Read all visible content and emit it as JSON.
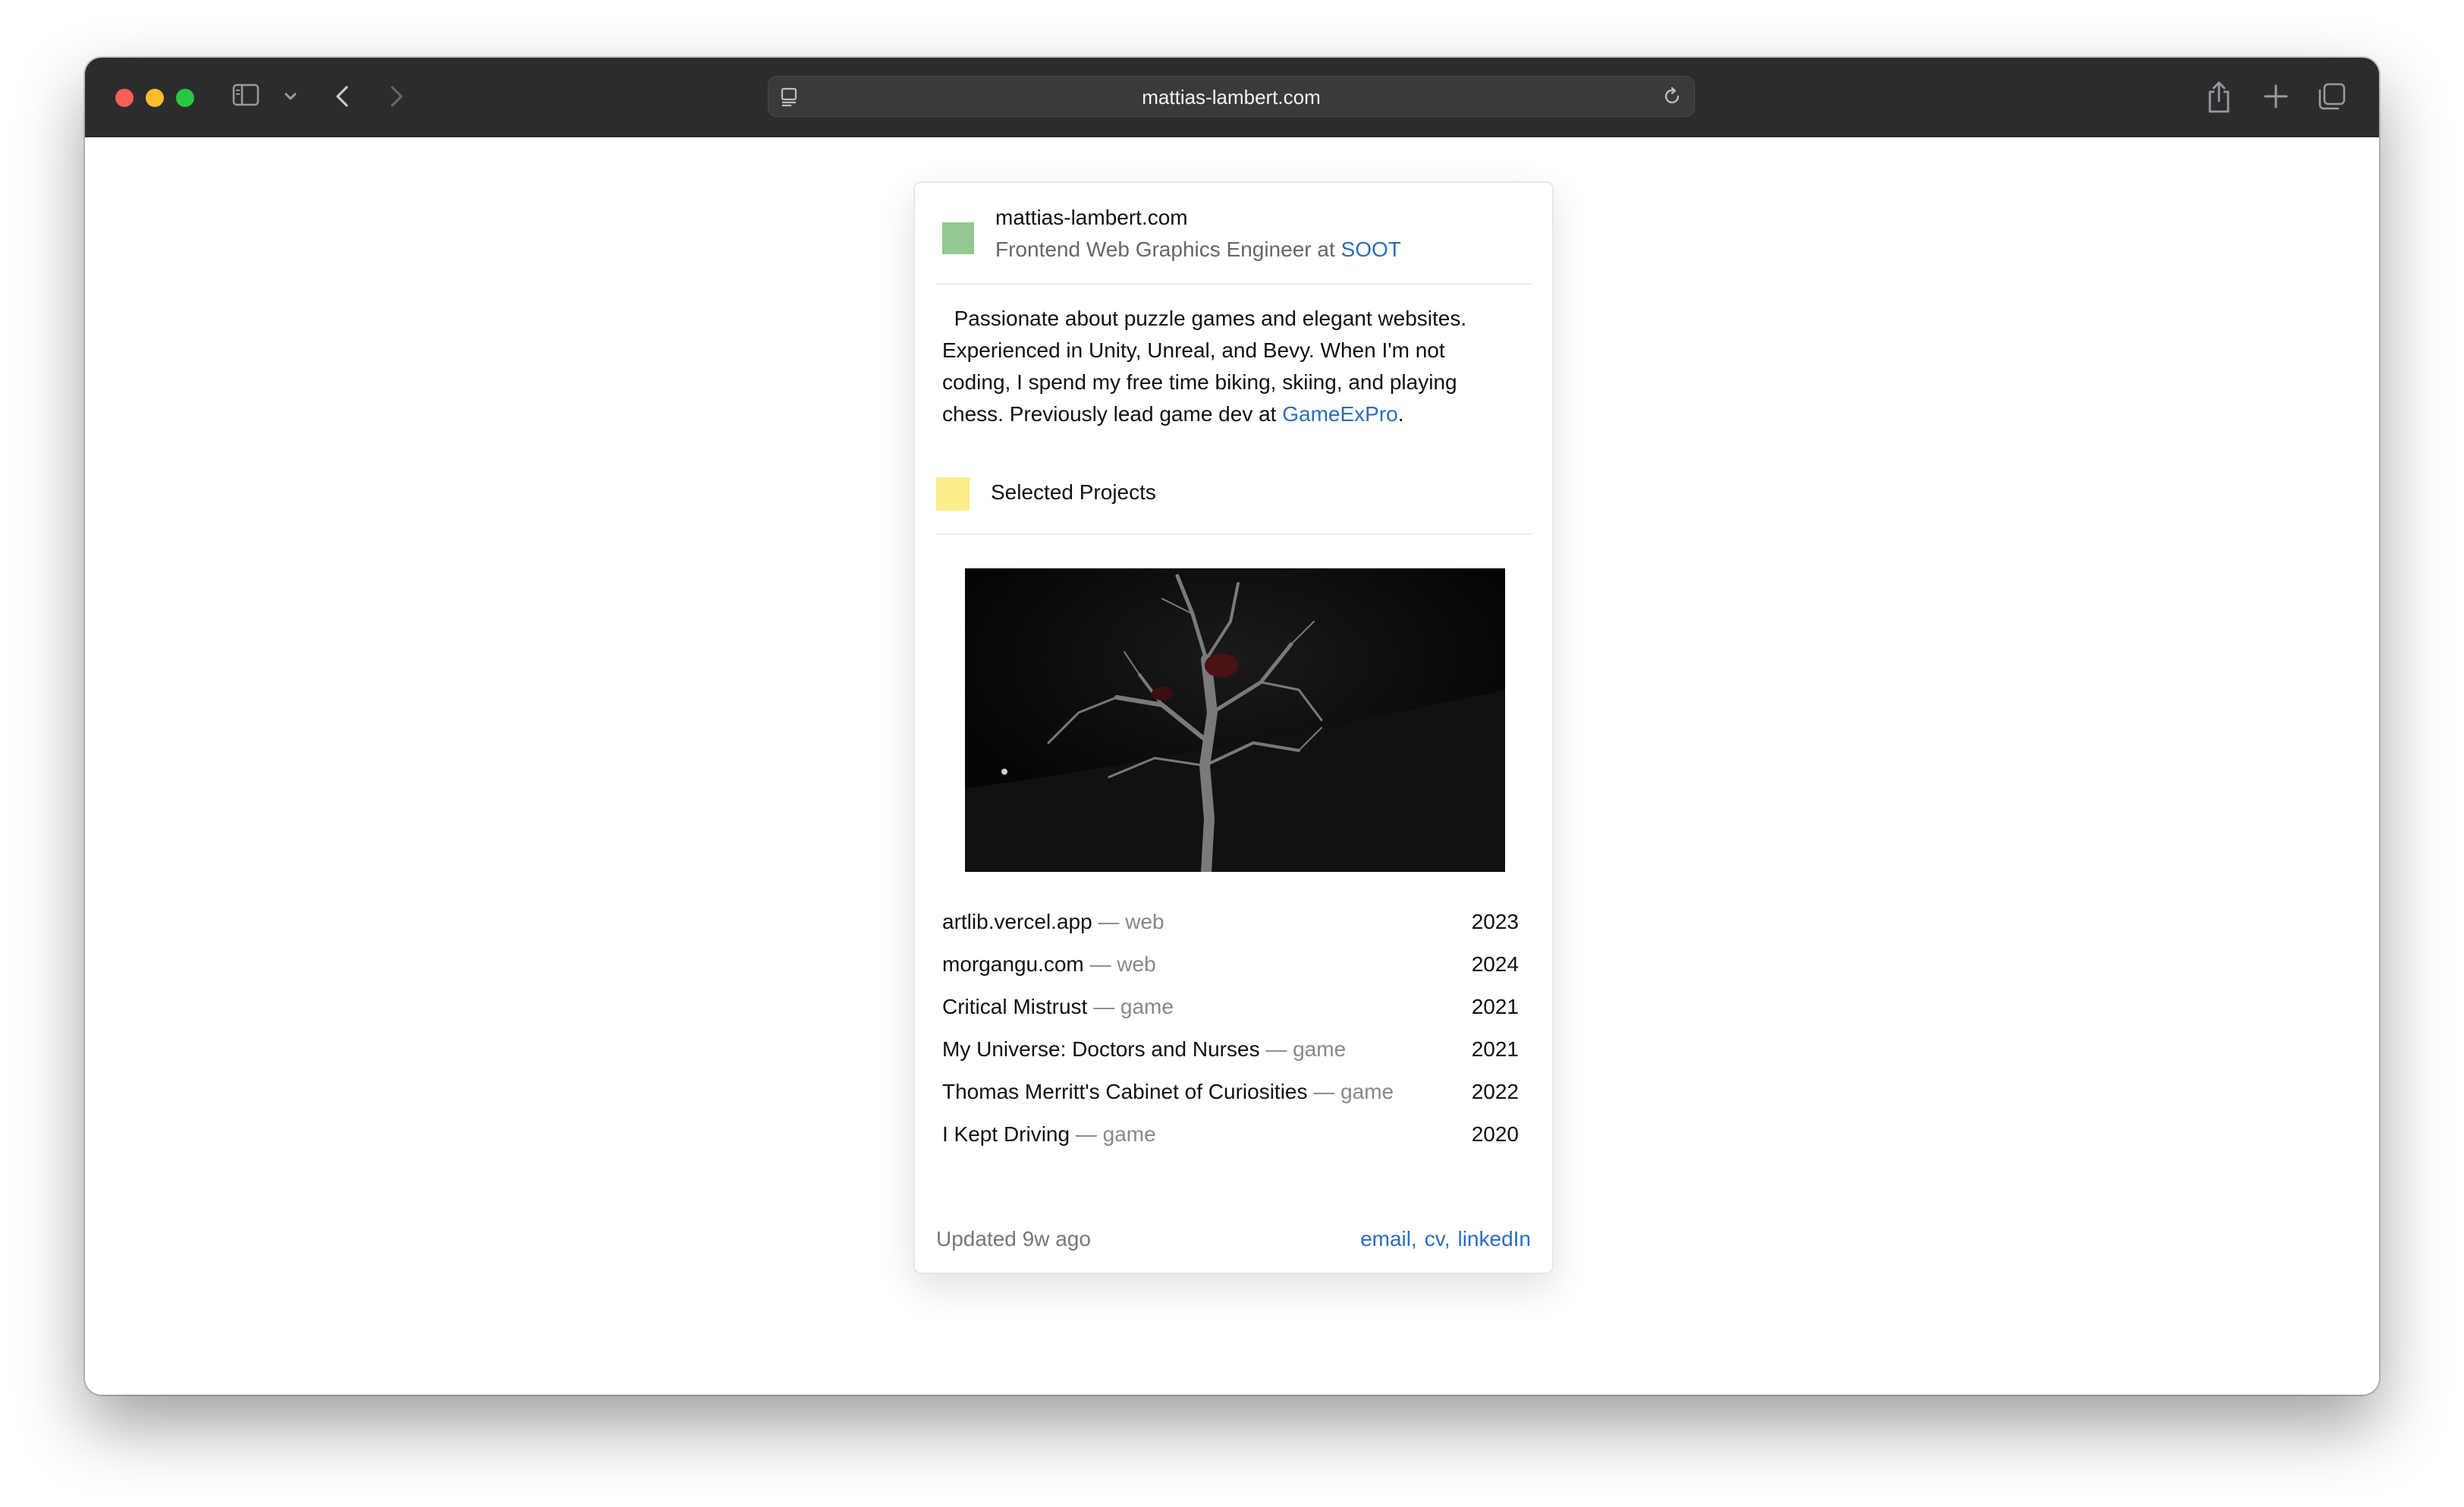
{
  "browser": {
    "url": "mattias-lambert.com"
  },
  "profile": {
    "site_name": "mattias-lambert.com",
    "role_prefix": "Frontend Web Graphics Engineer at",
    "company": "SOOT",
    "bio_text": "Passionate about puzzle games and elegant websites. Experienced in Unity, Unreal, and Bevy. When I'm not coding, I spend my free time biking, skiing, and playing chess. Previously lead game dev at",
    "previous_company": "GameExPro",
    "bio_end": "."
  },
  "projects_section": {
    "title": "Selected Projects",
    "separator": "—",
    "items": [
      {
        "name": "artlib.vercel.app",
        "kind": "web",
        "year": "2023"
      },
      {
        "name": "morgangu.com",
        "kind": "web",
        "year": "2024"
      },
      {
        "name": "Critical Mistrust",
        "kind": "game",
        "year": "2021"
      },
      {
        "name": "My Universe: Doctors and Nurses",
        "kind": "game",
        "year": "2021"
      },
      {
        "name": "Thomas Merritt's Cabinet of Curiosities",
        "kind": "game",
        "year": "2022"
      },
      {
        "name": "I Kept Driving",
        "kind": "game",
        "year": "2020"
      }
    ]
  },
  "footer": {
    "updated": "Updated 9w ago",
    "comma": ",",
    "links": {
      "email": "email",
      "cv": "cv",
      "linkedin": "linkedIn"
    }
  },
  "colors": {
    "toolbar": "#2c2c2e",
    "link": "#2a6ebd",
    "green_marker": "#93c891",
    "yellow_marker": "#fbec8b"
  },
  "icons": [
    "sidebar-icon",
    "chevron-down-icon",
    "back-arrow-icon",
    "forward-arrow-icon",
    "site-settings-icon",
    "reload-icon",
    "share-icon",
    "new-tab-icon",
    "tab-overview-icon"
  ]
}
